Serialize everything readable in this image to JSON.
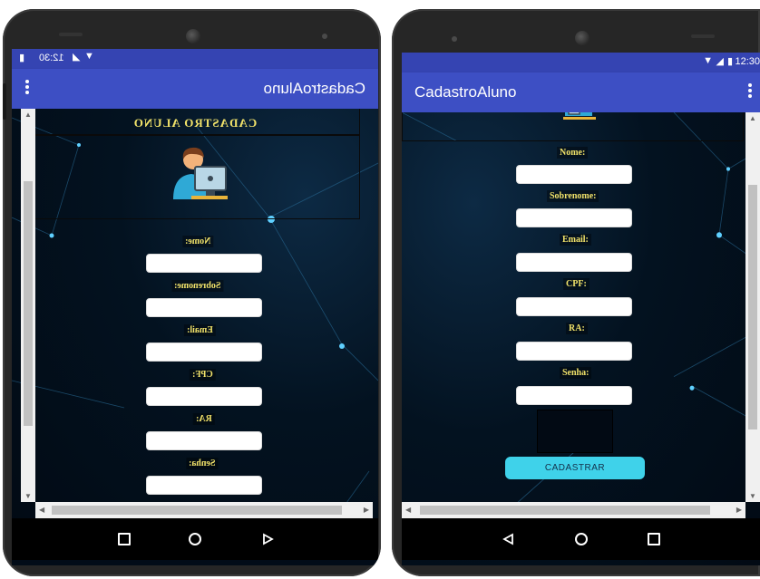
{
  "left_phone": {
    "status_time": "12:30",
    "app_title": "CadastroAluno",
    "header_title": "CADASTRO ALUNO",
    "fields": [
      {
        "label": "Nome:",
        "value": ""
      },
      {
        "label": "Sobrenome:",
        "value": ""
      },
      {
        "label": "Email:",
        "value": ""
      },
      {
        "label": "CPF:",
        "value": ""
      },
      {
        "label": "RA:",
        "value": ""
      },
      {
        "label": "Senha:",
        "value": ""
      }
    ]
  },
  "right_phone": {
    "status_time": "12:30",
    "app_title": "CadastroAluno",
    "fields": [
      {
        "label": "Nome:",
        "value": ""
      },
      {
        "label": "Sobrenome:",
        "value": ""
      },
      {
        "label": "Email:",
        "value": ""
      },
      {
        "label": "CPF:",
        "value": ""
      },
      {
        "label": "RA:",
        "value": ""
      },
      {
        "label": "Senha:",
        "value": ""
      }
    ],
    "submit_label": "CADASTRAR"
  },
  "colors": {
    "app_bar": "#3d4fc4",
    "status_bar": "#3544b2",
    "label_text": "#f2e36a",
    "button": "#3fd2ea",
    "background": "#020c18"
  },
  "icons": {
    "menu": "more-vert-icon",
    "student": "student-computer-icon",
    "nav_back": "triangle-back-icon",
    "nav_home": "circle-home-icon",
    "nav_recent": "square-recent-icon"
  }
}
